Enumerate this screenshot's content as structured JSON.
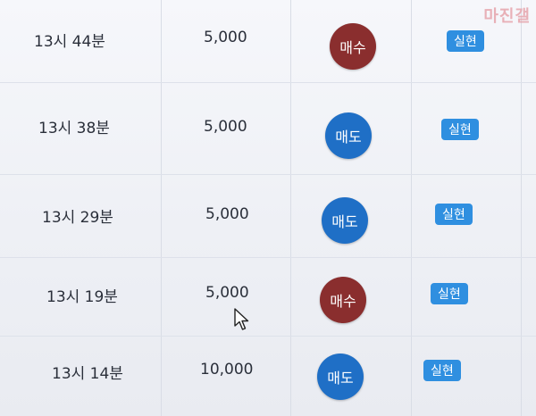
{
  "colors": {
    "buy": "#8a2e2e",
    "sell": "#1f6fc6",
    "realized": "#2f8fe0"
  },
  "watermark": "마진갤",
  "rows": [
    {
      "time": "13시 44분",
      "amount": "5,000",
      "side": "매수",
      "side_type": "buy",
      "status": "실현"
    },
    {
      "time": "13시 38분",
      "amount": "5,000",
      "side": "매도",
      "side_type": "sell",
      "status": "실현"
    },
    {
      "time": "13시 29분",
      "amount": "5,000",
      "side": "매도",
      "side_type": "sell",
      "status": "실현"
    },
    {
      "time": "13시 19분",
      "amount": "5,000",
      "side": "매수",
      "side_type": "buy",
      "status": "실현"
    },
    {
      "time": "13시 14분",
      "amount": "10,000",
      "side": "매도",
      "side_type": "sell",
      "status": "실현"
    }
  ]
}
